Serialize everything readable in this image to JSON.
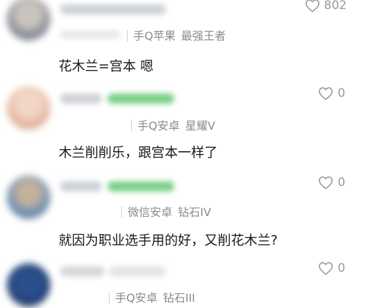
{
  "comments": [
    {
      "likes": "802",
      "device": "手Q苹果",
      "rank": "最强王者",
      "text": "花木兰=宫本 嗯",
      "avatar_color": "#8a8f98"
    },
    {
      "likes": "0",
      "device": "手Q安卓",
      "rank": "星耀V",
      "text": "木兰削削乐，跟宫本一样了",
      "avatar_color": "#e6b8a0"
    },
    {
      "likes": "0",
      "device": "微信安卓",
      "rank": "钻石IV",
      "text": "就因为职业选手用的好，又削花木兰?",
      "avatar_color": "#6f8fb5"
    },
    {
      "likes": "0",
      "device": "手Q安卓",
      "rank": "钻石III",
      "text": "",
      "avatar_color": "#1f3a6e"
    }
  ],
  "colors": {
    "text": "#1a1a1a",
    "meta": "#8a8a8a",
    "like": "#9a9a9a",
    "badge_green": "#7bd08a"
  },
  "icons": {
    "like": "heart-outline-icon"
  }
}
